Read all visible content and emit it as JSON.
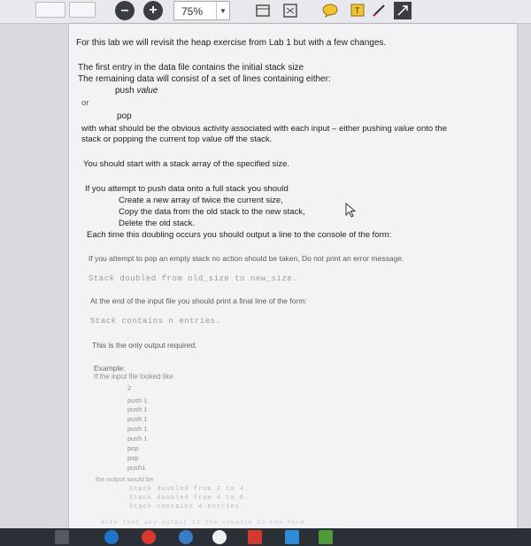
{
  "toolbar": {
    "zoom": "75%",
    "icons": [
      "minus-icon",
      "plus-icon",
      "fit-page-icon",
      "fullscreen-icon",
      "comment-icon",
      "text-box-icon",
      "pen-icon",
      "expand-icon"
    ]
  },
  "doc": {
    "intro": "For this lab we will revisit the heap exercise from Lab 1 but with a few changes.",
    "first_entry": "The first entry in the data file contains the initial stack size",
    "remaining": "The remaining data will consist of a set of lines containing either:",
    "push_cmd": "push",
    "push_value": "value",
    "or": "or",
    "pop_cmd": "pop",
    "activity_1a": "with what should be the obvious activity associated with each input – either pushing",
    "activity_1b": "value",
    "activity_1c": "onto the",
    "activity_2": "stack or popping the current top value off the stack.",
    "start_with": "You should start with a stack array of the specified size.",
    "full_stack": "If you attempt to push data onto a full stack you should",
    "step_1": "Create a new array of twice the current size,",
    "step_2": "Copy the data from the old stack to the new stack,",
    "step_3": "Delete the old stack.",
    "doubling": "Each time this doubling occurs you should output a line to the console of the form:",
    "empty_pop": "If you attempt to pop an empty stack no action should be taken, Do not print an error message.",
    "doubled_format": "Stack doubled from old_size to new_size.",
    "end_of_file": "At the end of the input file you should print a final line of the form:",
    "contains_format": "Stack contains n entries.",
    "only_output": "This is the only output required.",
    "example_label": "Example:",
    "if_input": "If the input file looked like",
    "input_lines": [
      "2",
      "push 1",
      "push 1",
      "push 1",
      "push 1",
      "push 1",
      "pop",
      "pop",
      "push1"
    ],
    "output_label": "the output would be",
    "output_lines": [
      "Stack doubled from 2 to 4.",
      "Stack doubled from 4 to 8.",
      "Stack contains 4 entries."
    ],
    "cut_off": "Note that any output to the console in the form"
  }
}
